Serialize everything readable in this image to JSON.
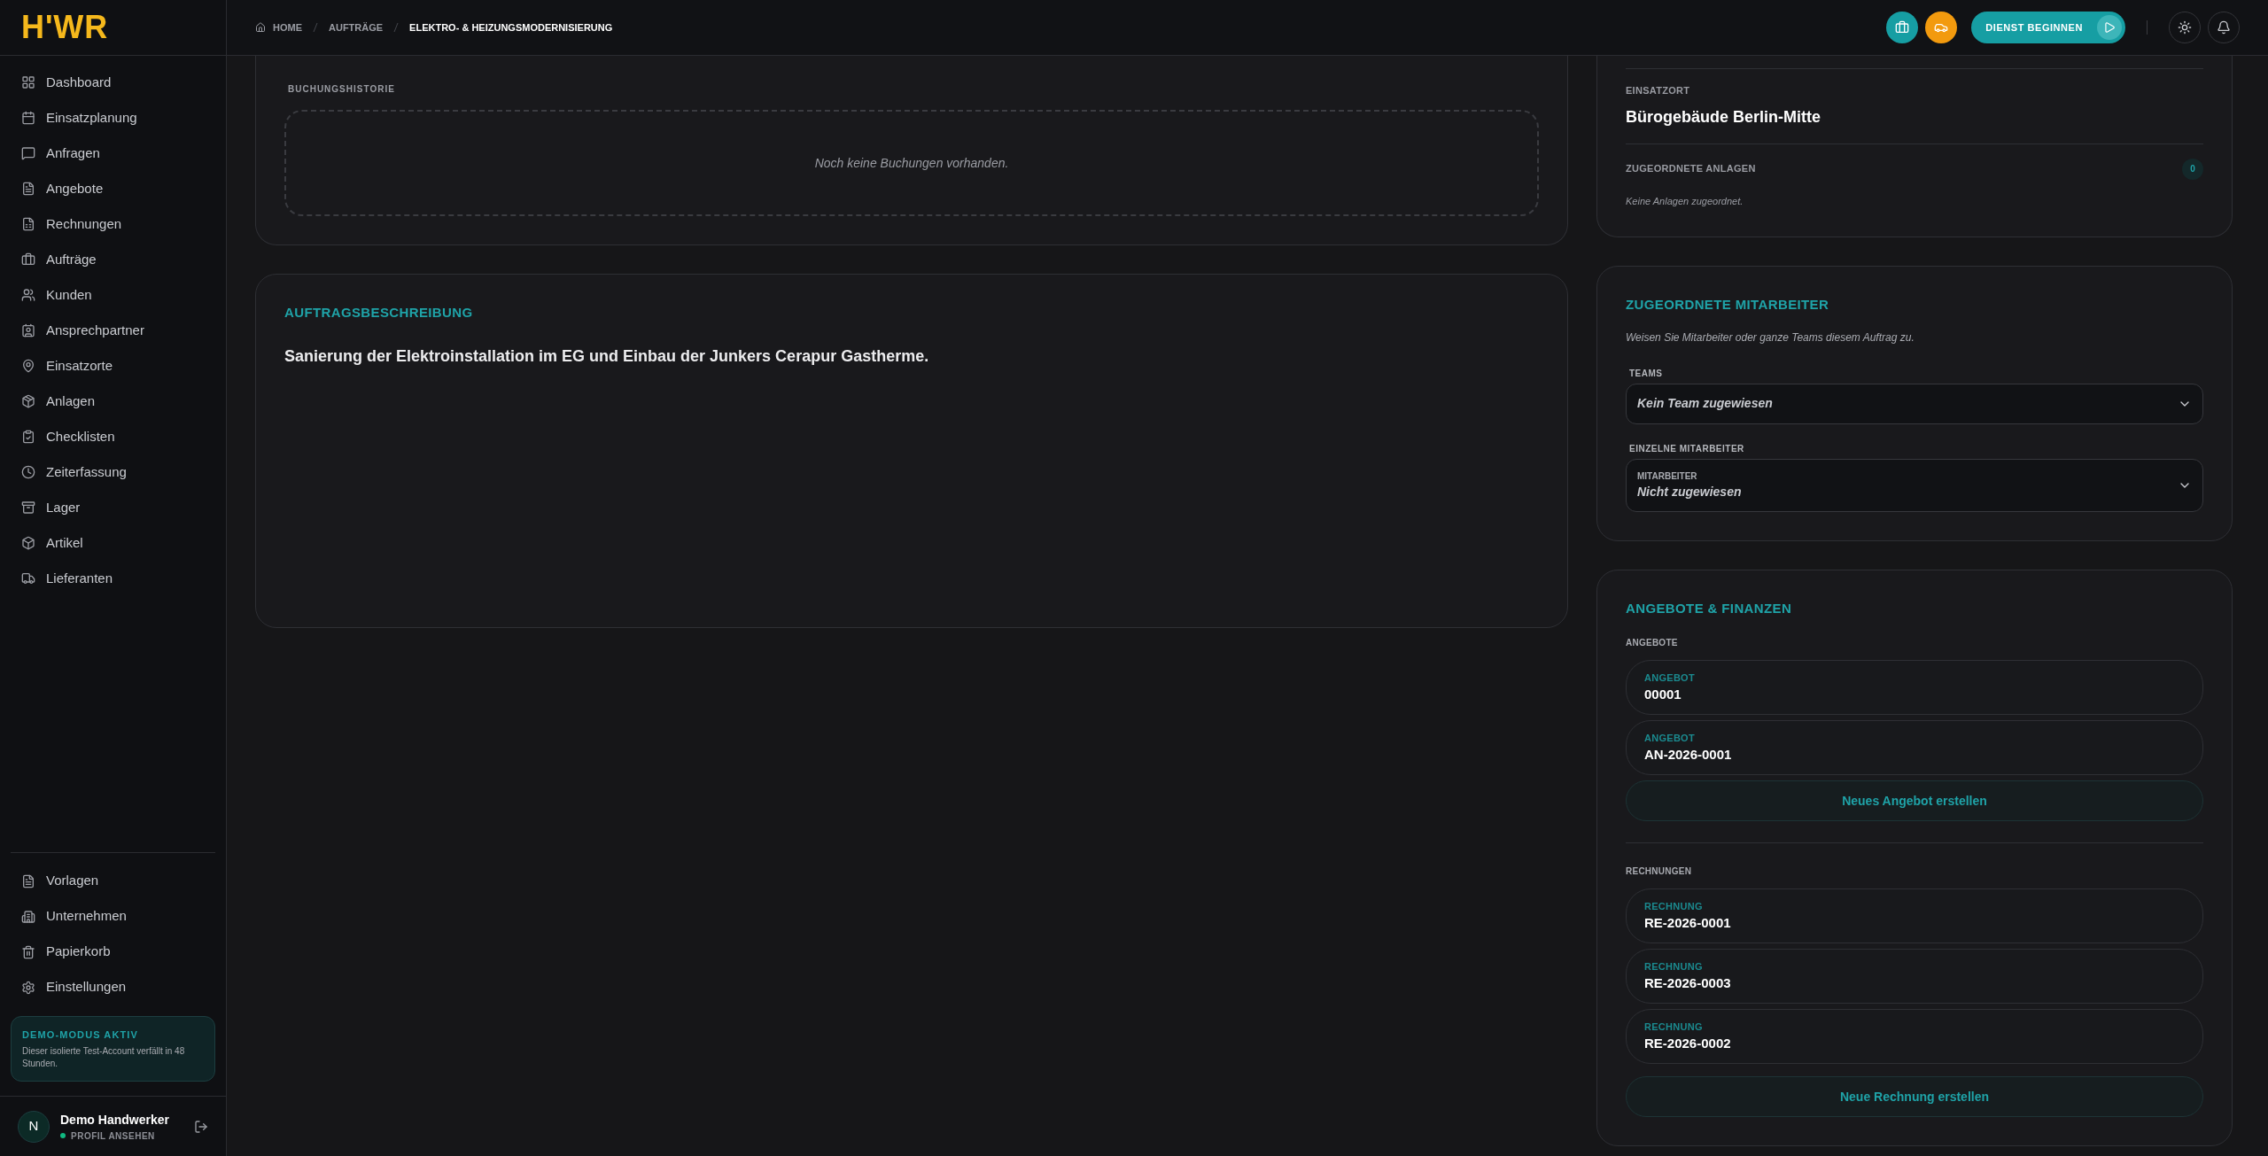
{
  "logo": "H'WR",
  "breadcrumbs": [
    {
      "label": "HOME",
      "current": false
    },
    {
      "label": "AUFTRÄGE",
      "current": false
    },
    {
      "label": "ELEKTRO- & HEIZUNGSMODERNISIERUNG",
      "current": true
    }
  ],
  "shift_button": "DIENST BEGINNEN",
  "sidebar": {
    "items": [
      "Dashboard",
      "Einsatzplanung",
      "Anfragen",
      "Angebote",
      "Rechnungen",
      "Aufträge",
      "Kunden",
      "Ansprechpartner",
      "Einsatzorte",
      "Anlagen",
      "Checklisten",
      "Zeiterfassung",
      "Lager",
      "Artikel",
      "Lieferanten"
    ],
    "footer_items": [
      "Vorlagen",
      "Unternehmen",
      "Papierkorb",
      "Einstellungen"
    ],
    "demo_notice": {
      "title": "DEMO-MODUS AKTIV",
      "text": "Dieser isolierte Test-Account verfällt in 48 Stunden."
    },
    "user": {
      "initial": "N",
      "name": "Demo Handwerker",
      "link": "PROFIL ANSEHEN",
      "online": true
    }
  },
  "booking_history": {
    "title": "BUCHUNGSHISTORIE",
    "empty_text": "Noch keine Buchungen vorhanden."
  },
  "description": {
    "title": "AUFTRAGSBESCHREIBUNG",
    "text": "Sanierung der Elektroinstallation im EG und Einbau der Junkers Cerapur Gastherme."
  },
  "location_card": {
    "location_label": "EINSATZORT",
    "location": "Bürogebäude Berlin-Mitte",
    "assets_label": "ZUGEORDNETE ANLAGEN",
    "assets_count": "0",
    "assets_empty": "Keine Anlagen zugeordnet."
  },
  "staff_card": {
    "title": "ZUGEORDNETE MITARBEITER",
    "hint": "Weisen Sie Mitarbeiter oder ganze Teams diesem Auftrag zu.",
    "teams_label": "TEAMS",
    "teams_value": "Kein Team zugewiesen",
    "individual_label": "EINZELNE MITARBEITER",
    "individual_field_label": "MITARBEITER",
    "individual_value": "Nicht zugewiesen"
  },
  "finance_card": {
    "title": "ANGEBOTE & FINANZEN",
    "offers_label": "ANGEBOTE",
    "offers": [
      {
        "label": "ANGEBOT",
        "number": "00001"
      },
      {
        "label": "ANGEBOT",
        "number": "AN-2026-0001"
      }
    ],
    "new_offer": "Neues Angebot erstellen",
    "invoices_label": "RECHNUNGEN",
    "invoices": [
      {
        "label": "RECHNUNG",
        "number": "RE-2026-0001"
      },
      {
        "label": "RECHNUNG",
        "number": "RE-2026-0003"
      },
      {
        "label": "RECHNUNG",
        "number": "RE-2026-0002"
      }
    ],
    "new_invoice": "Neue Rechnung erstellen"
  }
}
